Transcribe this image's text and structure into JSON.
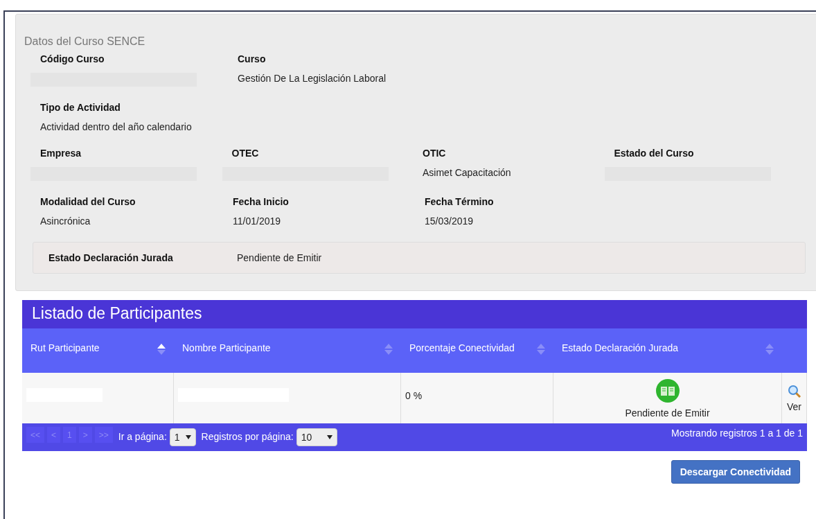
{
  "course_panel": {
    "title": "Datos del Curso SENCE",
    "rows": [
      [
        {
          "label": "Código Curso",
          "redacted": true
        },
        {
          "label": "Curso",
          "value": "Gestión De La Legislación Laboral"
        }
      ],
      [
        {
          "label": "Tipo de Actividad",
          "value": "Actividad dentro del año calendario"
        }
      ],
      [
        {
          "label": "Empresa",
          "redacted": true
        },
        {
          "label": "OTEC",
          "redacted": true
        },
        {
          "label": "OTIC",
          "value": "Asimet Capacitación"
        },
        {
          "label": "Estado del Curso",
          "redacted": true
        }
      ],
      [
        {
          "label": "Modalidad del Curso",
          "value": "Asincrónica"
        },
        {
          "label": "Fecha Inicio",
          "value": "11/01/2019"
        },
        {
          "label": "Fecha Término",
          "value": "15/03/2019"
        }
      ]
    ],
    "declaration": {
      "label": "Estado Declaración Jurada",
      "value": "Pendiente de Emitir"
    }
  },
  "participants": {
    "title": "Listado de Participantes",
    "columns": [
      {
        "label": "Rut Participante",
        "sorted_ascending": true
      },
      {
        "label": "Nombre Participante",
        "sorted_ascending": false
      },
      {
        "label": "Porcentaje Conectividad",
        "sorted_ascending": false
      },
      {
        "label": "Estado Declaración Jurada",
        "sorted_ascending": false
      }
    ],
    "rows": [
      {
        "rut": {
          "redacted": true
        },
        "name": {
          "redacted": true
        },
        "percent": "0 %",
        "status": "Pendiente de Emitir",
        "action": "Ver"
      }
    ],
    "pager": {
      "buttons": [
        "<<",
        "<",
        "1",
        ">",
        ">>"
      ],
      "goto_label": "Ir a página:",
      "page": "1",
      "per_page_label": "Registros por página:",
      "per_page": "10",
      "summary": "Mostrando registros 1 a 1 de 1"
    }
  },
  "download_button": "Descargar Conectividad"
}
